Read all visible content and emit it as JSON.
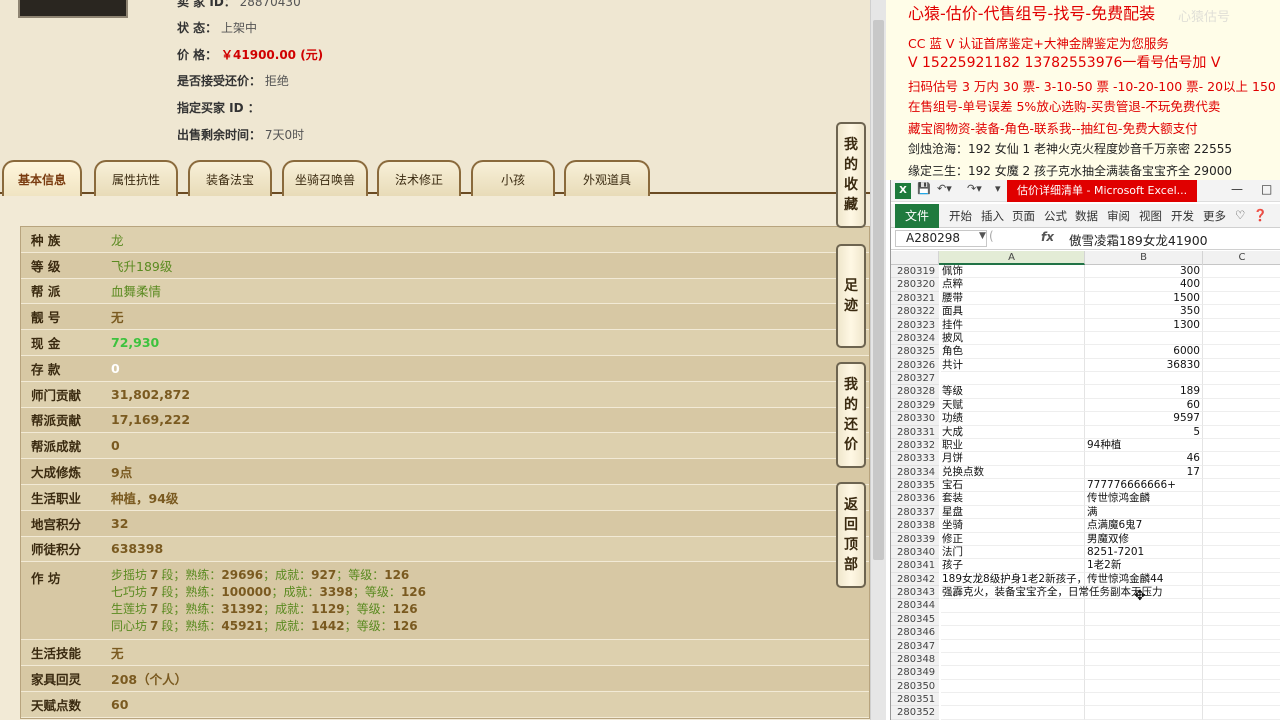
{
  "game": {
    "info": {
      "seller_id_label": "卖  家  ID：",
      "seller_id_value": "28870430",
      "status_label": "状      态：",
      "status_value": "上架中",
      "price_label": "价      格：",
      "price_value": "￥41900.00 (元)",
      "counter_offer_label": "是否接受还价：",
      "counter_offer_value": "拒绝",
      "buyer_id_label": "指定买家 ID ：",
      "buyer_id_value": "",
      "time_left_label": "出售剩余时间：",
      "time_left_value": "7天0时"
    },
    "tabs": [
      "基本信息",
      "属性抗性",
      "装备法宝",
      "坐骑召唤兽",
      "法术修正",
      "小孩",
      "外观道具"
    ],
    "attrs": [
      {
        "label": "种    族",
        "value": "龙",
        "style": "green"
      },
      {
        "label": "等    级",
        "value": "飞升189级",
        "style": "green"
      },
      {
        "label": "帮    派",
        "value": "血舞柔情",
        "style": "green"
      },
      {
        "label": "靓    号",
        "value": "无",
        "style": ""
      },
      {
        "label": "现    金",
        "value": "72,930",
        "style": "lightgreen"
      },
      {
        "label": "存    款",
        "value": "0",
        "style": "white"
      },
      {
        "label": "师门贡献",
        "value": "31,802,872",
        "style": ""
      },
      {
        "label": "帮派贡献",
        "value": "17,169,222",
        "style": ""
      },
      {
        "label": "帮派成就",
        "value": "0",
        "style": ""
      },
      {
        "label": "大成修炼",
        "value": "9点",
        "style": ""
      },
      {
        "label": "生活职业",
        "value": "种植，94级",
        "style": ""
      },
      {
        "label": "地宫积分",
        "value": "32",
        "style": ""
      },
      {
        "label": "师徒积分",
        "value": "638398",
        "style": ""
      }
    ],
    "workshop": {
      "label": "作    坊",
      "lines": [
        {
          "name": "步摇坊",
          "level": "7",
          "skill": "29696",
          "achieve": "927",
          "grade": "126"
        },
        {
          "name": "七巧坊",
          "level": "7",
          "skill": "100000",
          "achieve": "3398",
          "grade": "126"
        },
        {
          "name": "生莲坊",
          "level": "7",
          "skill": "31392",
          "achieve": "1129",
          "grade": "126"
        },
        {
          "name": "同心坊",
          "level": "7",
          "skill": "45921",
          "achieve": "1442",
          "grade": "126"
        }
      ],
      "seg_word": "段；熟练：",
      "ach_word": "；成就：",
      "grade_word": "；等级："
    },
    "attrs2": [
      {
        "label": "生活技能",
        "value": "无",
        "style": ""
      },
      {
        "label": "家具回灵",
        "value": "208（个人）",
        "style": ""
      },
      {
        "label": "天赋点数",
        "value": "60",
        "style": ""
      }
    ],
    "side_buttons": [
      "我的收藏",
      "足迹",
      "我的还价",
      "返回顶部"
    ]
  },
  "ad": {
    "lines": [
      "心猿-估价-代售组号-找号-免费配装",
      "CC 蓝 V 认证首席鉴定+大神金牌鉴定为您服务",
      "V 15225921182     13782553976一看号估号加 V",
      "扫码估号 3 万内 30 票- 3-10-50 票  -10-20-100 票- 20以上 150",
      "在售组号-单号误差 5%放心选购-买贵管退-不玩免费代卖",
      "藏宝阁物资-装备-角色-联系我--抽红包-免费大额支付",
      "剑烛沧海：192 女仙 1 老神火克火程度妙音千万亲密 22555",
      "缘定三生：192 女魔 2 孩子克水抽全满装备宝宝齐全 29000"
    ],
    "watermark": "心猿估号"
  },
  "excel": {
    "title": "估价详细清单 - Microsoft Excel...",
    "ribbon_tabs": [
      "开始",
      "插入",
      "页面",
      "公式",
      "数据",
      "审阅",
      "视图",
      "开发",
      "更多"
    ],
    "file_tab": "文件",
    "name_box": "A280298",
    "fx": "fx",
    "formula_value": "傲雪凌霜189女龙41900",
    "columns": [
      "A",
      "B",
      "C"
    ],
    "rows": [
      {
        "n": "280319",
        "a": "佩饰",
        "b": "300",
        "num": true
      },
      {
        "n": "280320",
        "a": "点粹",
        "b": "400",
        "num": true
      },
      {
        "n": "280321",
        "a": "腰带",
        "b": "1500",
        "num": true
      },
      {
        "n": "280322",
        "a": "面具",
        "b": "350",
        "num": true
      },
      {
        "n": "280323",
        "a": "挂件",
        "b": "1300",
        "num": true
      },
      {
        "n": "280324",
        "a": "披风",
        "b": "",
        "num": true
      },
      {
        "n": "280325",
        "a": "角色",
        "b": "6000",
        "num": true
      },
      {
        "n": "280326",
        "a": "共计",
        "b": "36830",
        "num": true
      },
      {
        "n": "280327",
        "a": "",
        "b": "",
        "num": true
      },
      {
        "n": "280328",
        "a": "等级",
        "b": "189",
        "num": true
      },
      {
        "n": "280329",
        "a": "天赋",
        "b": "60",
        "num": true
      },
      {
        "n": "280330",
        "a": "功绩",
        "b": "9597",
        "num": true
      },
      {
        "n": "280331",
        "a": "大成",
        "b": "5",
        "num": true
      },
      {
        "n": "280332",
        "a": "职业",
        "b": "94种植",
        "num": false
      },
      {
        "n": "280333",
        "a": "月饼",
        "b": "46",
        "num": true
      },
      {
        "n": "280334",
        "a": "兑换点数",
        "b": "17",
        "num": true
      },
      {
        "n": "280335",
        "a": "宝石",
        "b": "777776666666+",
        "num": false
      },
      {
        "n": "280336",
        "a": "套装",
        "b": "传世惊鸿金麟",
        "num": false
      },
      {
        "n": "280337",
        "a": "星盘",
        "b": "满",
        "num": false
      },
      {
        "n": "280338",
        "a": "坐骑",
        "b": "点满魔6鬼7",
        "num": false
      },
      {
        "n": "280339",
        "a": "修正",
        "b": "男魔双修",
        "num": false
      },
      {
        "n": "280340",
        "a": "法门",
        "b": "8251-7201",
        "num": false
      },
      {
        "n": "280341",
        "a": "孩子",
        "b": "1老2新",
        "num": false
      },
      {
        "n": "280342",
        "a": "189女龙8级护身1老2新孩子，传世惊鸿金麟44",
        "b": "",
        "num": false
      },
      {
        "n": "280343",
        "a": "强霹克火，装备宝宝齐全，日常任务副本无压力",
        "b": "",
        "num": false
      },
      {
        "n": "280344",
        "a": "",
        "b": "",
        "num": false
      },
      {
        "n": "280345",
        "a": "",
        "b": "",
        "num": false
      },
      {
        "n": "280346",
        "a": "",
        "b": "",
        "num": false
      },
      {
        "n": "280347",
        "a": "",
        "b": "",
        "num": false
      },
      {
        "n": "280348",
        "a": "",
        "b": "",
        "num": false
      },
      {
        "n": "280349",
        "a": "",
        "b": "",
        "num": false
      },
      {
        "n": "280350",
        "a": "",
        "b": "",
        "num": false
      },
      {
        "n": "280351",
        "a": "",
        "b": "",
        "num": false
      },
      {
        "n": "280352",
        "a": "",
        "b": "",
        "num": false
      }
    ]
  }
}
